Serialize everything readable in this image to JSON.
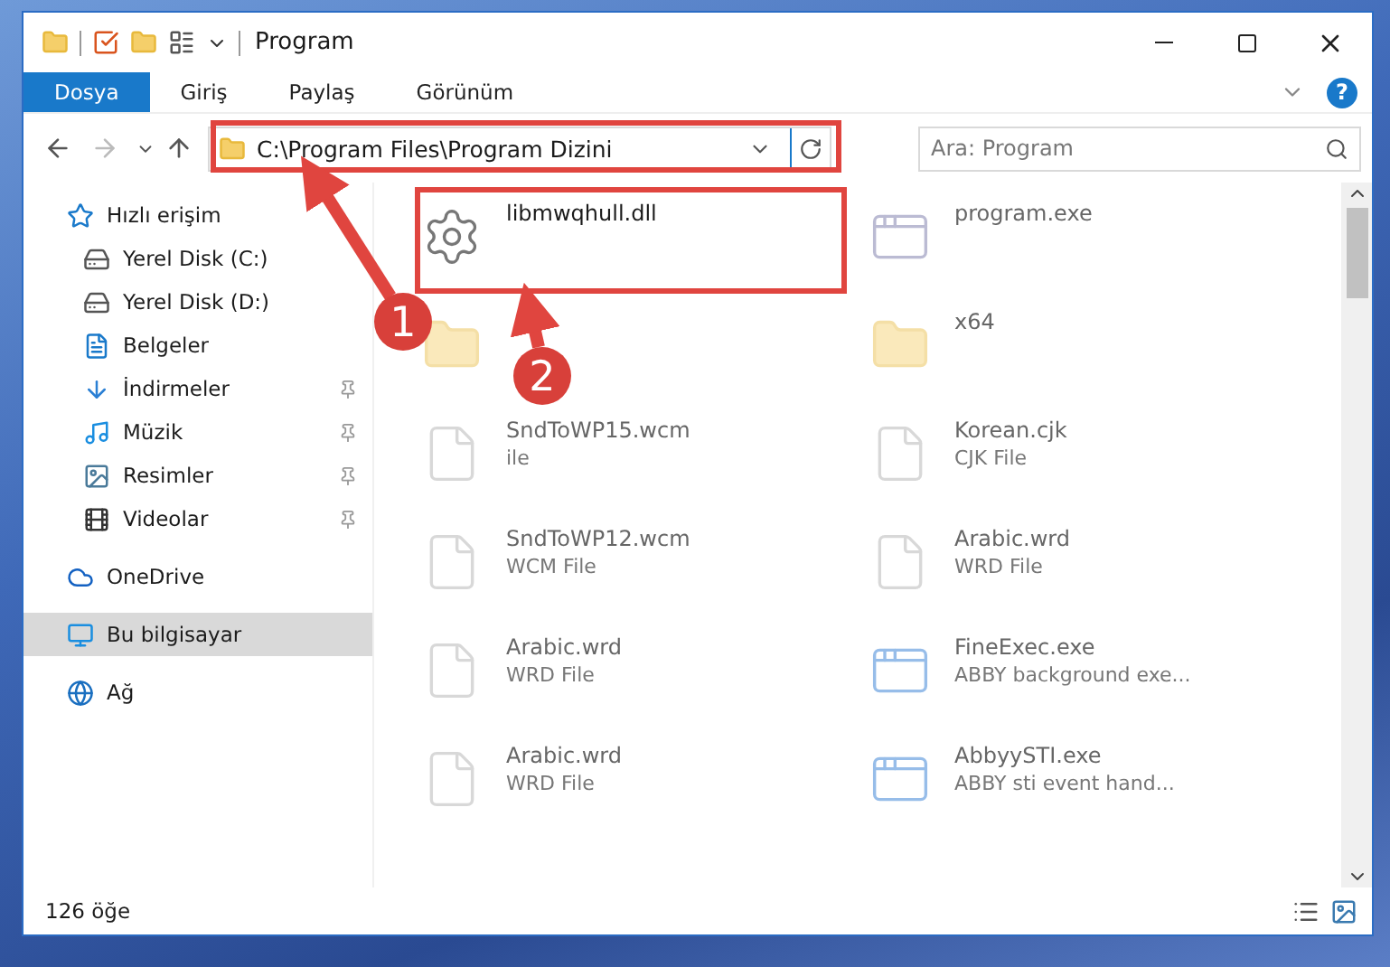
{
  "window": {
    "title": "Program"
  },
  "ribbon": {
    "tabs": [
      {
        "label": "Dosya",
        "selected": true
      },
      {
        "label": "Giriş",
        "selected": false
      },
      {
        "label": "Paylaş",
        "selected": false
      },
      {
        "label": "Görünüm",
        "selected": false
      }
    ],
    "help": "?"
  },
  "address_bar": {
    "path": "C:\\Program Files\\Program Dizini"
  },
  "search": {
    "placeholder": "Ara: Program"
  },
  "sidebar": {
    "items": [
      {
        "label": "Hızlı erişim",
        "selected": false,
        "children": [
          {
            "label": "Yerel Disk (C:)",
            "pinned": false,
            "selected": false
          },
          {
            "label": "Yerel Disk (D:)",
            "pinned": false,
            "selected": false
          },
          {
            "label": "Belgeler",
            "pinned": false,
            "selected": false
          },
          {
            "label": "İndirmeler",
            "pinned": true,
            "selected": false
          },
          {
            "label": "Müzik",
            "pinned": true,
            "selected": false
          },
          {
            "label": "Resimler",
            "pinned": true,
            "selected": false
          },
          {
            "label": "Videolar",
            "pinned": true,
            "selected": false
          }
        ]
      },
      {
        "label": "OneDrive",
        "selected": false
      },
      {
        "label": "Bu bilgisayar",
        "selected": true
      },
      {
        "label": "Ağ",
        "selected": false
      }
    ]
  },
  "files": [
    {
      "kind": "dll",
      "name": "libmwqhull.dll",
      "highlighted": true
    },
    {
      "kind": "exe",
      "name": "program.exe",
      "highlighted": false
    },
    {
      "kind": "folder",
      "highlighted": false
    },
    {
      "kind": "folder",
      "name": "x64",
      "highlighted": false
    },
    {
      "kind": "doc",
      "name": "SndToWP15.wcm",
      "type": "ile",
      "highlighted": false
    },
    {
      "kind": "doc",
      "name": "Korean.cjk",
      "type": "CJK File",
      "highlighted": false
    },
    {
      "kind": "doc",
      "name": "SndToWP12.wcm",
      "type": "WCM File",
      "highlighted": false
    },
    {
      "kind": "doc",
      "name": "Arabic.wrd",
      "type": "WRD File",
      "highlighted": false
    },
    {
      "kind": "doc",
      "name": "Arabic.wrd",
      "type": "WRD File",
      "highlighted": false
    },
    {
      "kind": "app",
      "name": "FineExec.exe",
      "type": "ABBY background exe...",
      "highlighted": false
    },
    {
      "kind": "doc",
      "name": "Arabic.wrd",
      "type": "WRD File",
      "highlighted": false
    },
    {
      "kind": "app",
      "name": "AbbyySTI.exe",
      "type": "ABBY sti event hand...",
      "highlighted": false
    }
  ],
  "status_bar": {
    "count": "126 öğe"
  },
  "annotations": [
    {
      "label": "1"
    },
    {
      "label": "2"
    }
  ]
}
